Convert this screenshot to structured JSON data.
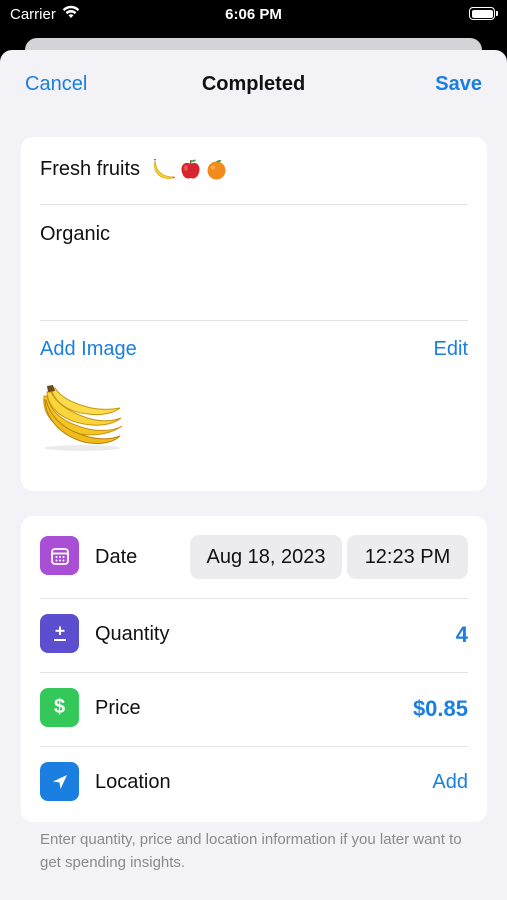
{
  "status_bar": {
    "carrier": "Carrier",
    "time": "6:06 PM"
  },
  "nav": {
    "cancel_label": "Cancel",
    "title": "Completed",
    "save_label": "Save"
  },
  "item": {
    "title": "Fresh fruits",
    "emojis": [
      "banana",
      "apple",
      "orange"
    ],
    "notes": "Organic",
    "add_image_label": "Add Image",
    "edit_label": "Edit",
    "image": "banana-bunch"
  },
  "details": {
    "date": {
      "label": "Date",
      "date_value": "Aug 18, 2023",
      "time_value": "12:23 PM",
      "icon": "calendar-icon",
      "color": "#a94fd6"
    },
    "quantity": {
      "label": "Quantity",
      "value": "4",
      "icon": "plus-minus-icon",
      "color": "#5b4fcf"
    },
    "price": {
      "label": "Price",
      "value": "$0.85",
      "icon": "dollar-icon",
      "color": "#34c759"
    },
    "location": {
      "label": "Location",
      "action_label": "Add",
      "icon": "location-arrow-icon",
      "color": "#1a7fe0"
    }
  },
  "footer_note": "Enter quantity, price and location information if you later want to get spending insights.",
  "colors": {
    "accent": "#1a7fe0",
    "background": "#f2f2f7"
  }
}
